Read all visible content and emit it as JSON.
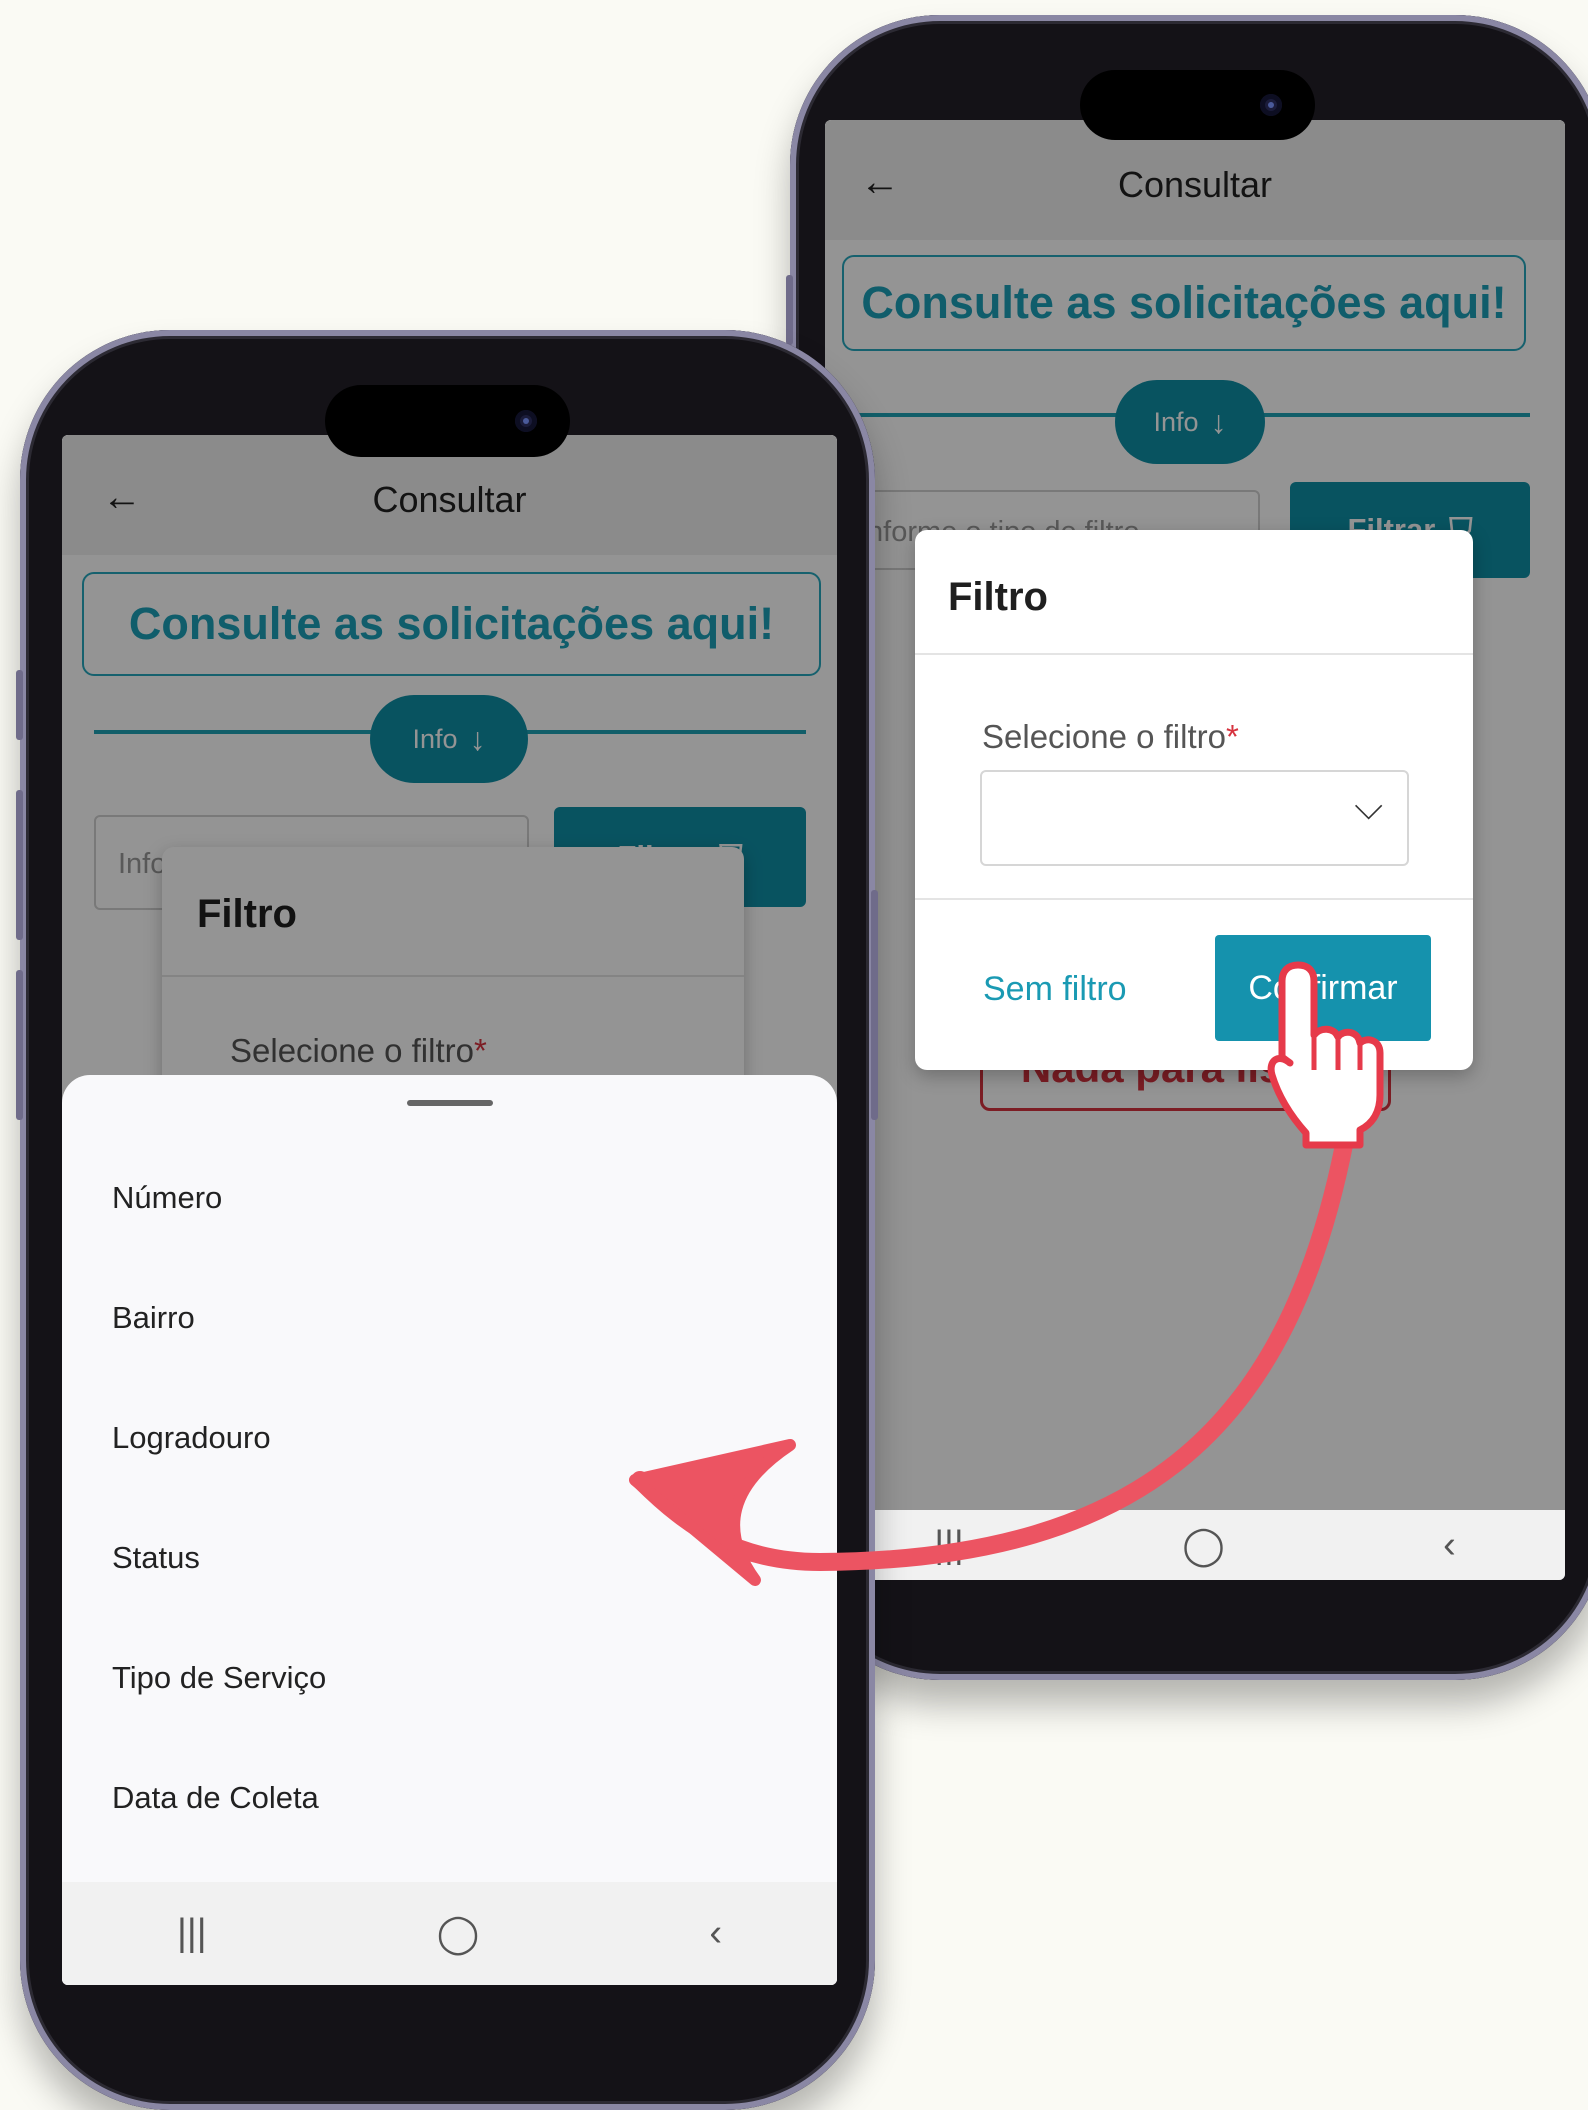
{
  "screens": [
    {
      "id": "back-phone",
      "appbar": {
        "back_glyph": "←",
        "title": "Consultar"
      },
      "banner": "Consulte as solicitações aqui!",
      "info_button": {
        "label": "Info",
        "icon": "arrow-down-icon",
        "glyph": "↓"
      },
      "search": {
        "placeholder": "Informe o tipo de filtro"
      },
      "filter_button": {
        "label": "Filtrar",
        "icon": "filter-icon",
        "glyph": "⛉"
      },
      "empty_state": "Nada para listar!",
      "dialog": {
        "title": "Filtro",
        "field_label": "Selecione o filtro",
        "required_mark": "*",
        "select_value": "",
        "chevron": "⌵",
        "secondary_action": "Sem filtro",
        "primary_action": "Confirmar"
      },
      "navbar": {
        "recent": "|||",
        "home": "◯",
        "back": "‹"
      }
    },
    {
      "id": "front-phone",
      "appbar": {
        "back_glyph": "←",
        "title": "Consultar"
      },
      "banner": "Consulte as solicitações aqui!",
      "info_button": {
        "label": "Info",
        "icon": "arrow-down-icon",
        "glyph": "↓"
      },
      "search": {
        "placeholder": "Informe o tipo de filtro"
      },
      "filter_button": {
        "label": "Filtrar",
        "icon": "filter-icon",
        "glyph": "⛉"
      },
      "dialog": {
        "title": "Filtro",
        "field_label": "Selecione o filtro",
        "required_mark": "*"
      },
      "sheet_options": [
        "Número",
        "Bairro",
        "Logradouro",
        "Status",
        "Tipo de Serviço",
        "Data de Coleta"
      ],
      "navbar": {
        "recent": "|||",
        "home": "◯",
        "back": "‹"
      }
    }
  ],
  "annotation": {
    "arrow_color": "#ec5462",
    "cursor": "hand-pointer-icon"
  }
}
